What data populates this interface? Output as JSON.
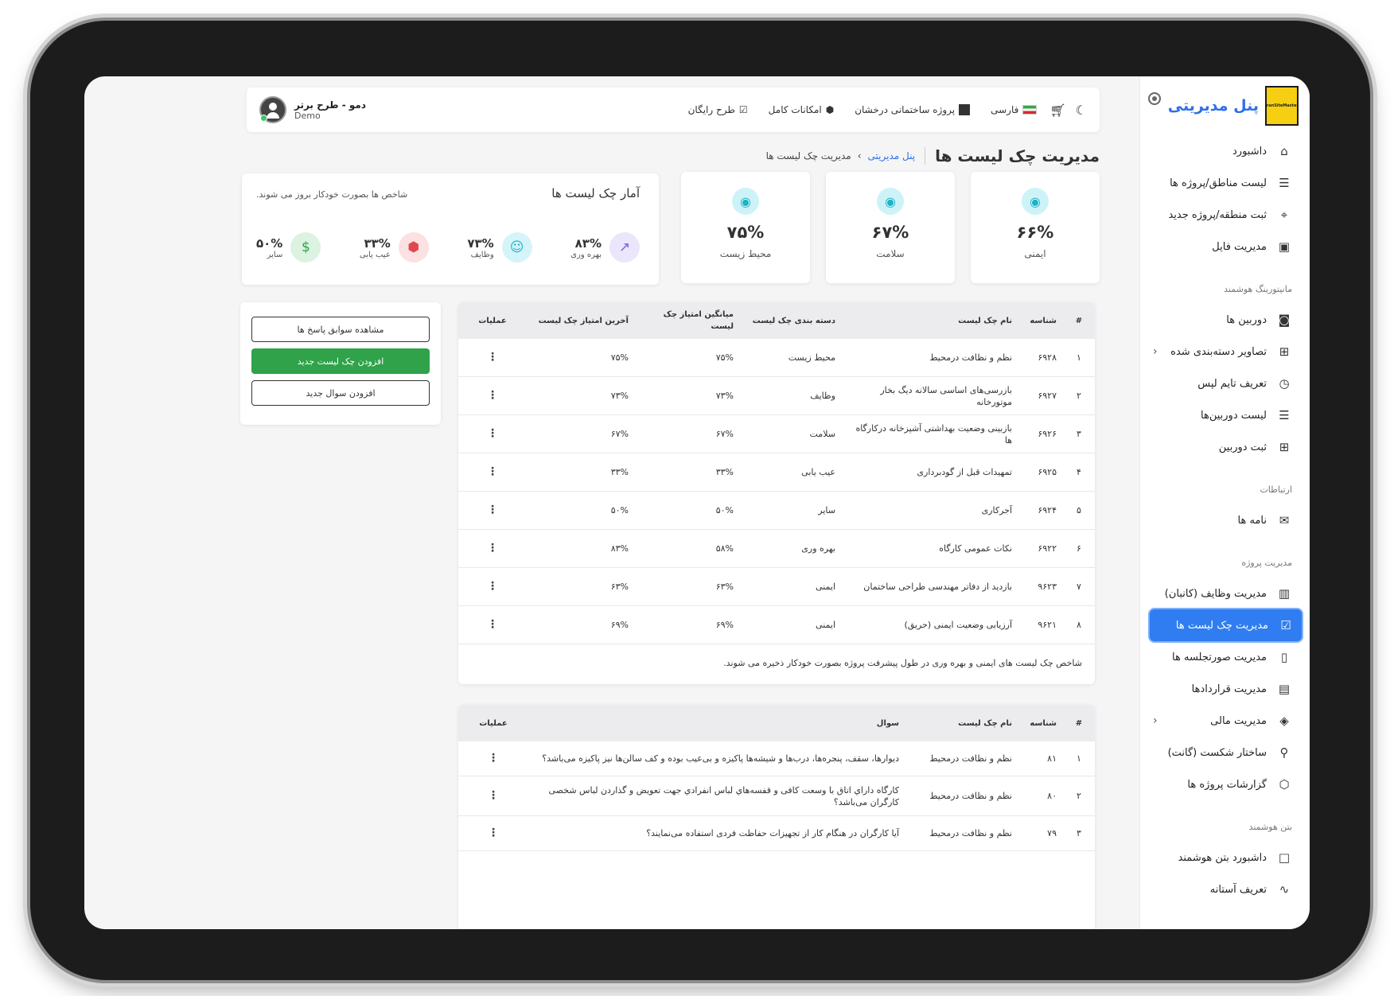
{
  "brand": {
    "title": "پنل مدیریتی",
    "logo_text": "iranSiteMaster"
  },
  "topbar": {
    "project": "پروژه ساختمانی درخشان",
    "language": "فارسی",
    "features": "امکانات کامل",
    "free_plan": "طرح رایگان",
    "user_name": "دمو - طرح برتر",
    "user_sub": "Demo"
  },
  "page": {
    "title": "مدیریت چک لیست ها",
    "breadcrumb_root": "پنل مدیریتی",
    "breadcrumb_current": "مدیریت چک لیست ها"
  },
  "sidebar": {
    "groups": [
      {
        "header": "",
        "items": [
          {
            "label": "داشبورد",
            "icon": "home-icon"
          },
          {
            "label": "لیست مناطق/پروژه ها",
            "icon": "list-icon"
          },
          {
            "label": "ثبت منطقه/پروژه جدید",
            "icon": "map-pin-icon"
          },
          {
            "label": "مدیریت فایل",
            "icon": "save-icon"
          }
        ]
      },
      {
        "header": "مانیتورینگ هوشمند",
        "items": [
          {
            "label": "دوربین ها",
            "icon": "camera-icon"
          },
          {
            "label": "تصاویر دسته‌بندی شده",
            "icon": "grid-icon",
            "chevron": true
          },
          {
            "label": "تعریف تایم لپس",
            "icon": "timer-icon"
          },
          {
            "label": "لیست دوربین‌ها",
            "icon": "list-icon"
          },
          {
            "label": "ثبت دوربین",
            "icon": "plus-square-icon"
          }
        ]
      },
      {
        "header": "ارتباطات",
        "items": [
          {
            "label": "نامه ها",
            "icon": "mail-icon"
          }
        ]
      },
      {
        "header": "مدیریت پروژه",
        "items": [
          {
            "label": "مدیریت وظایف (کانبان)",
            "icon": "kanban-icon"
          },
          {
            "label": "مدیریت چک لیست ها",
            "icon": "checkbox-icon",
            "active": true
          },
          {
            "label": "مدیریت صورتجلسه ها",
            "icon": "file-icon"
          },
          {
            "label": "مدیریت قراردادها",
            "icon": "document-icon"
          },
          {
            "label": "مدیریت مالی",
            "icon": "layers-icon",
            "chevron": true
          },
          {
            "label": "ساختار شکست (گانت)",
            "icon": "tree-icon"
          },
          {
            "label": "گزارشات پروژه ها",
            "icon": "box-icon"
          }
        ]
      },
      {
        "header": "بتن هوشمند",
        "items": [
          {
            "label": "داشبورد بتن هوشمند",
            "icon": "square-icon"
          },
          {
            "label": "تعریف آستانه",
            "icon": "pulse-icon"
          }
        ]
      }
    ]
  },
  "score_cards": [
    {
      "label": "ایمنی",
      "value": "۶۶%"
    },
    {
      "label": "سلامت",
      "value": "۶۷%"
    },
    {
      "label": "محیط زیست",
      "value": "۷۵%"
    }
  ],
  "stats": {
    "title": "آمار چک لیست ها",
    "note": "شاخص ها بصورت خودکار بروز می شوند.",
    "items": [
      {
        "label": "بهره وری",
        "value": "۸۳%",
        "icon": "trend-up-icon",
        "color": "#7b61d9",
        "bg": "#ebe6fb"
      },
      {
        "label": "وظایف",
        "value": "۷۳%",
        "icon": "user-icon",
        "color": "#1bb3c8",
        "bg": "#d5f4f8"
      },
      {
        "label": "عیب یابی",
        "value": "۳۳%",
        "icon": "cube-icon",
        "color": "#e0484f",
        "bg": "#fbe1e2"
      },
      {
        "label": "سایر",
        "value": "۵۰%",
        "icon": "dollar-icon",
        "color": "#2fa24a",
        "bg": "#dcf3e1"
      }
    ]
  },
  "actions": {
    "history": "مشاهده سوابق پاسخ ها",
    "add_checklist": "افزودن چک لیست جدید",
    "add_question": "افزودن سوال جدید"
  },
  "checklists": {
    "headers": [
      "#",
      "شناسه",
      "نام چک لیست",
      "دسته بندی چک لیست",
      "میانگین امتیاز چک لیست",
      "آخرین امتیاز چک لیست",
      "عملیات"
    ],
    "rows": [
      {
        "n": "۱",
        "id": "۶۹۲۸",
        "name": "نظم و نظافت درمحیط",
        "cat": "محیط زیست",
        "avg": "۷۵%",
        "last": "۷۵%"
      },
      {
        "n": "۲",
        "id": "۶۹۲۷",
        "name": "بازرسی‌های اساسی سالانه دیگ بخار موتورخانه",
        "cat": "وظایف",
        "avg": "۷۳%",
        "last": "۷۳%"
      },
      {
        "n": "۳",
        "id": "۶۹۲۶",
        "name": "بازبینی وضعیت بهداشتی آشپزخانه درکارگاه ها",
        "cat": "سلامت",
        "avg": "۶۷%",
        "last": "۶۷%"
      },
      {
        "n": "۴",
        "id": "۶۹۲۵",
        "name": "تمهیدات قبل از گودبرداری",
        "cat": "عیب یابی",
        "avg": "۳۳%",
        "last": "۳۳%"
      },
      {
        "n": "۵",
        "id": "۶۹۲۴",
        "name": "آجرکاری",
        "cat": "سایر",
        "avg": "۵۰%",
        "last": "۵۰%"
      },
      {
        "n": "۶",
        "id": "۶۹۲۲",
        "name": "نکات عمومی کارگاه",
        "cat": "بهره وری",
        "avg": "۵۸%",
        "last": "۸۳%"
      },
      {
        "n": "۷",
        "id": "۹۶۲۳",
        "name": "بازدید از دفاتر مهندسی طراحی ساختمان",
        "cat": "ایمنی",
        "avg": "۶۳%",
        "last": "۶۳%"
      },
      {
        "n": "۸",
        "id": "۹۶۲۱",
        "name": "آرزیابی وضعیت ایمنی (حریق)",
        "cat": "ایمنی",
        "avg": "۶۹%",
        "last": "۶۹%"
      }
    ],
    "footer": "شاخص چک لیست های ایمنی و بهره وری در طول پیشرفت پروژه بصورت خودکار ذخیره می شوند."
  },
  "questions": {
    "headers": [
      "#",
      "شناسه",
      "نام چک لیست",
      "سوال",
      "عملیات"
    ],
    "rows": [
      {
        "n": "۱",
        "id": "۸۱",
        "name": "نظم و نظافت درمحیط",
        "q": "دیوارها، سقف، پنجره‌ها، درب‌ها و شیشه‌ها پاکیزه و بی‌عیب بوده و کف سالن‌ها نیز پاکیزه می‌باشد؟"
      },
      {
        "n": "۲",
        "id": "۸۰",
        "name": "نظم و نظافت درمحیط",
        "q": "كارگاه داراي اتاق با وسعت كافی و قفسه‌هاي لباس انفرادي جهت تعويض و گذاردن لباس شخصی كارگران می‌باشد؟"
      },
      {
        "n": "۳",
        "id": "۷۹",
        "name": "نظم و نظافت درمحیط",
        "q": "آیا کارگران در هنگام کار از تجهیزات حفاظت فردی استفاده می‌نمایند؟"
      }
    ]
  },
  "icons": {
    "moon": "moon-icon",
    "cart": "cart-icon",
    "kebab": "kebab-icon"
  }
}
